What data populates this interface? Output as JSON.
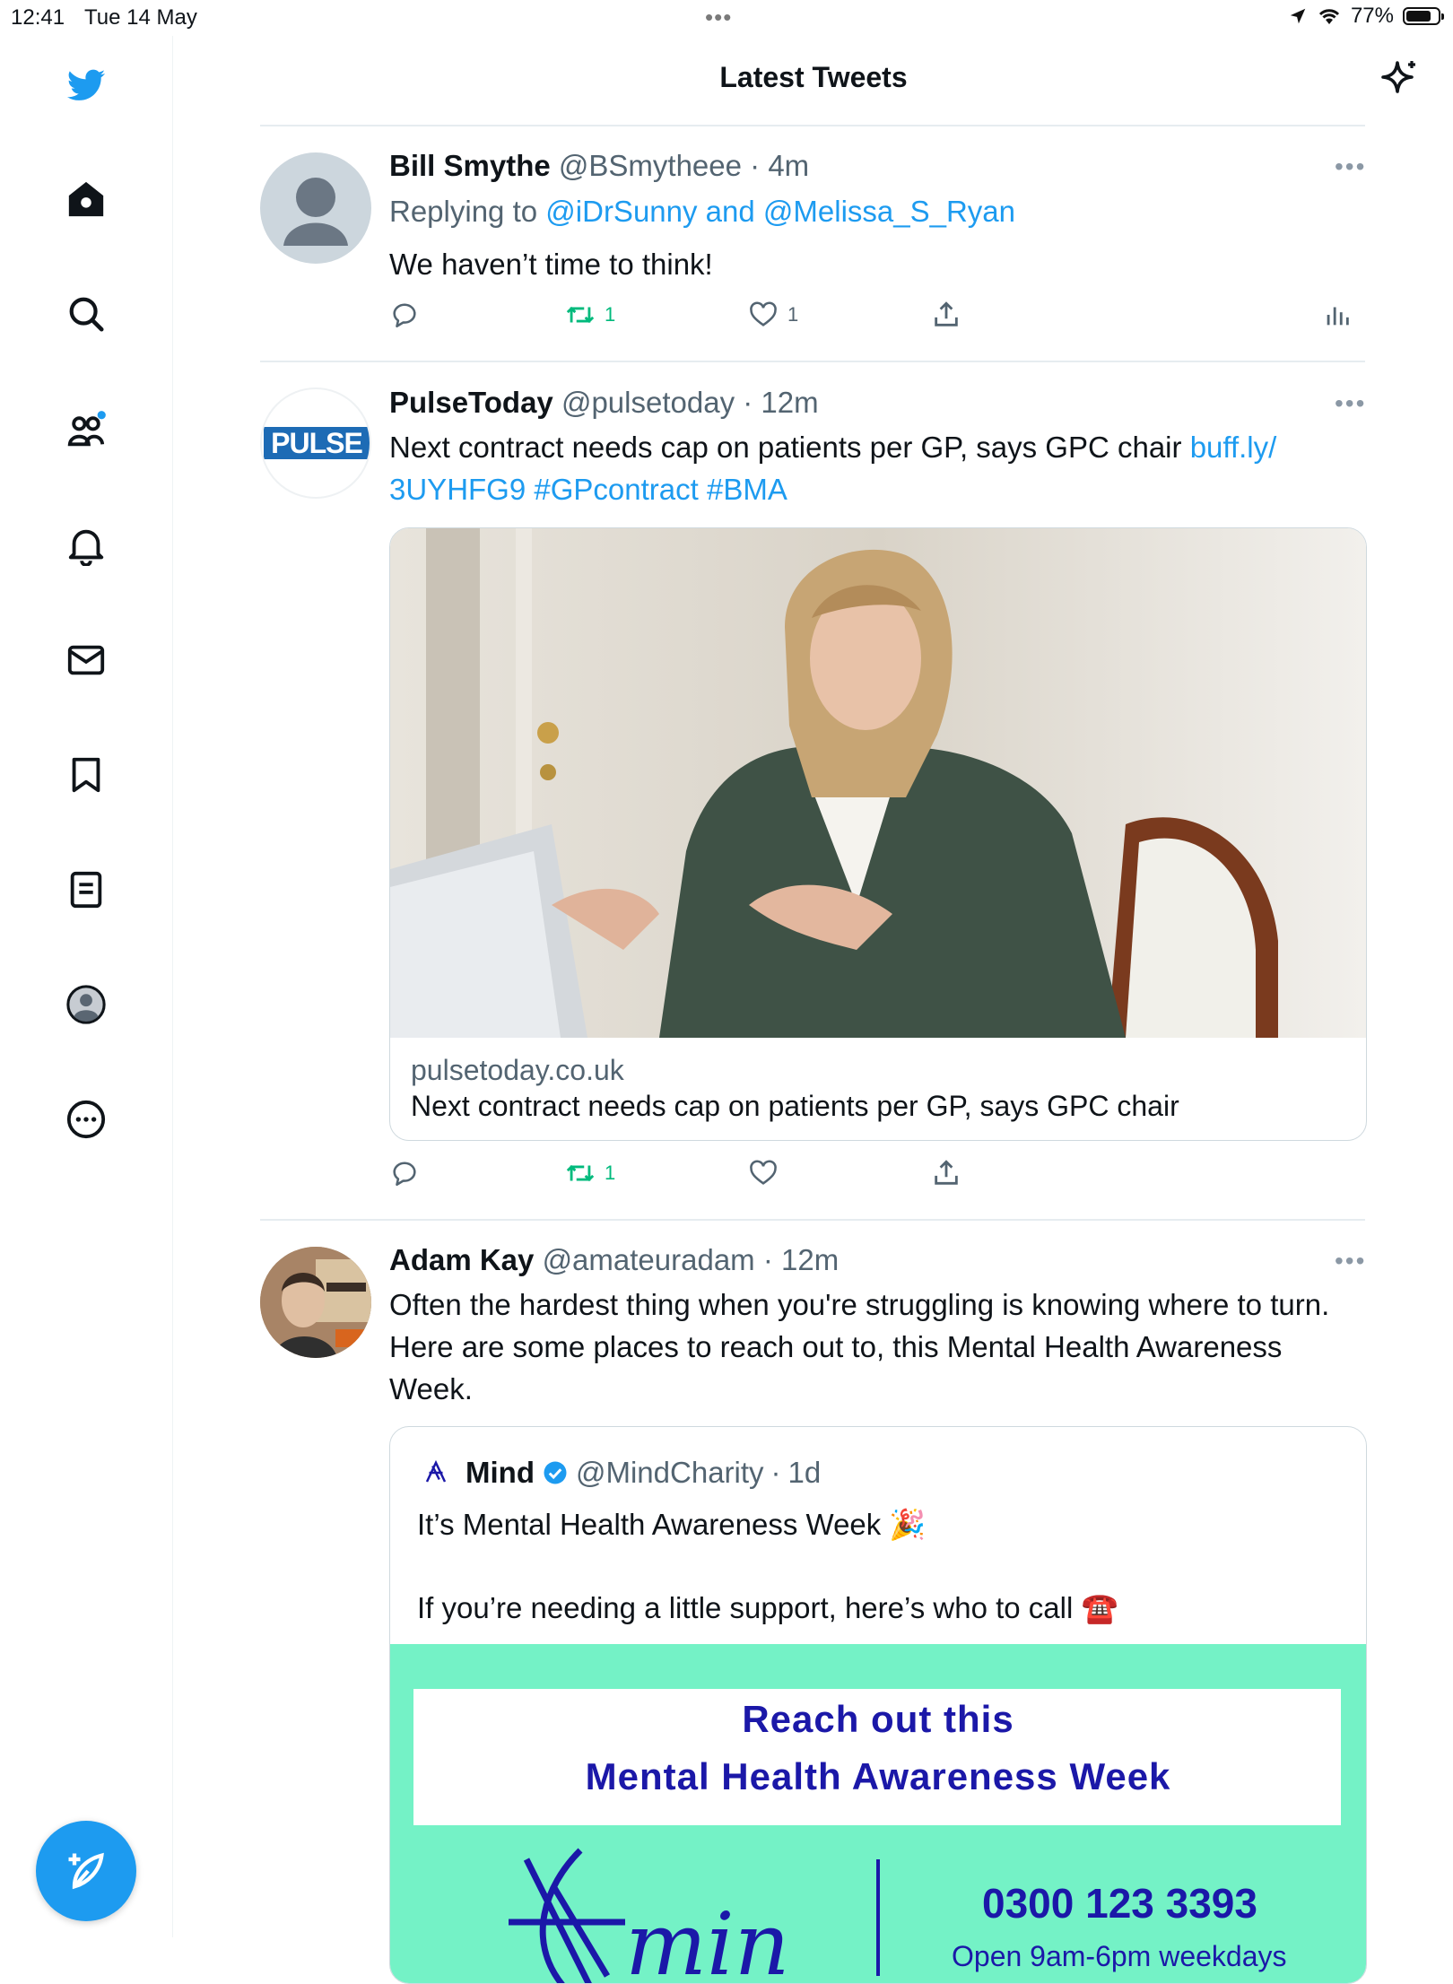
{
  "status_bar": {
    "time": "12:41",
    "date": "Tue 14 May",
    "battery": "77%",
    "battery_level": 0.77
  },
  "sidebar": {
    "items": [
      {
        "name": "home",
        "icon": "home-icon"
      },
      {
        "name": "search",
        "icon": "search-icon"
      },
      {
        "name": "communities",
        "icon": "people-icon",
        "has_dot": true
      },
      {
        "name": "notifications",
        "icon": "bell-icon"
      },
      {
        "name": "messages",
        "icon": "envelope-icon"
      },
      {
        "name": "bookmarks",
        "icon": "bookmark-icon"
      },
      {
        "name": "lists",
        "icon": "list-icon"
      },
      {
        "name": "profile",
        "icon": "avatar-icon"
      },
      {
        "name": "more",
        "icon": "more-icon"
      }
    ],
    "compose_icon": "compose-icon"
  },
  "header": {
    "title": "Latest Tweets"
  },
  "colors": {
    "accent": "#1d9bf0",
    "retweet": "#00ba7c",
    "secondary_text": "#536471",
    "mind_green": "#74f2c6",
    "mind_blue": "#1b18a8"
  },
  "tweets": [
    {
      "name": "Bill Smythe",
      "handle": "@BSmytheee",
      "time": "4m",
      "reply_prefix": "Replying to",
      "reply_targets": "@iDrSunny and @Melissa_S_Ryan",
      "text": "We haven’t time to think!",
      "retweets": "1",
      "likes": "1"
    },
    {
      "name": "PulseToday",
      "handle": "@pulsetoday",
      "time": "12m",
      "avatar_text": "PULSE",
      "text": "Next contract needs cap on patients per GP, says GPC chair",
      "link_1": "buff.ly/",
      "link_2": "3UYHFG9",
      "hashtag_1": "#GPcontract",
      "hashtag_2": "#BMA",
      "card_domain": "pulsetoday.co.uk",
      "card_title": "Next contract needs cap on patients per GP, says GPC chair",
      "retweets": "1"
    },
    {
      "name": "Adam Kay",
      "handle": "@amateuradam",
      "time": "12m",
      "text": "Often the hardest thing when you're struggling is knowing where to turn. Here are some places to reach out to, this Mental Health Awareness Week.",
      "quote": {
        "name": "Mind",
        "handle": "@MindCharity",
        "time": "1d",
        "line_1": "It’s Mental Health Awareness Week 🎉",
        "line_2": "If you’re needing a little support, here’s who to call ☎️",
        "banner_line_1": "Reach out this",
        "banner_line_2": "Mental Health Awareness Week",
        "phone": "0300 123 3393",
        "hours": "Open 9am-6pm weekdays"
      }
    }
  ]
}
